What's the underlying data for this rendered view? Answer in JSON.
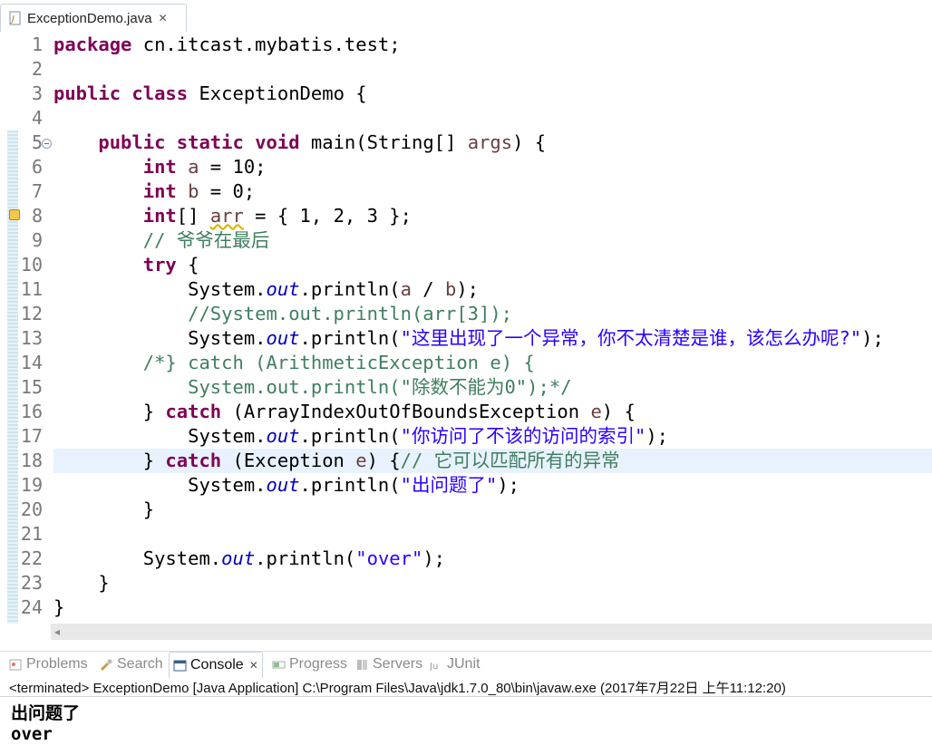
{
  "editor_tab": {
    "label": "ExceptionDemo.java"
  },
  "line_numbers": [
    "1",
    "2",
    "3",
    "4",
    "5",
    "6",
    "7",
    "8",
    "9",
    "10",
    "11",
    "12",
    "13",
    "14",
    "15",
    "16",
    "17",
    "18",
    "19",
    "20",
    "21",
    "22",
    "23",
    "24"
  ],
  "code": {
    "l1": [
      "package",
      " cn.itcast.mybatis.test;"
    ],
    "l3": [
      "public",
      " ",
      "class",
      " ExceptionDemo {"
    ],
    "l5": [
      "    ",
      "public",
      " ",
      "static",
      " ",
      "void",
      " main(String[] ",
      "args",
      ") {"
    ],
    "l6": [
      "        ",
      "int",
      " ",
      "a",
      " = 10;"
    ],
    "l7": [
      "        ",
      "int",
      " ",
      "b",
      " = 0;"
    ],
    "l8": [
      "        ",
      "int",
      "[] ",
      "arr",
      " = { 1, 2, 3 };"
    ],
    "l9": [
      "        ",
      "// 爷爷在最后"
    ],
    "l10": [
      "        ",
      "try",
      " {"
    ],
    "l11": [
      "            System.",
      "out",
      ".println(",
      "a",
      " / ",
      "b",
      ");"
    ],
    "l12": [
      "            ",
      "//System.out.println(arr[3]);"
    ],
    "l13": [
      "            System.",
      "out",
      ".println(",
      "\"这里出现了一个异常，你不太清楚是谁，该怎么办呢?\"",
      ");"
    ],
    "l14": [
      "        ",
      "/*} catch (ArithmeticException e) {"
    ],
    "l15": [
      "            ",
      "System.out.println(\"除数不能为0\");*/"
    ],
    "l16": [
      "        } ",
      "catch",
      " (ArrayIndexOutOfBoundsException ",
      "e",
      ") {"
    ],
    "l17": [
      "            System.",
      "out",
      ".println(",
      "\"你访问了不该的访问的索引\"",
      ");"
    ],
    "l18": [
      "        } ",
      "catch",
      " (Exception ",
      "e",
      ") {",
      "// 它可以匹配所有的异常"
    ],
    "l19": [
      "            System.",
      "out",
      ".println(",
      "\"出问题了\"",
      ");"
    ],
    "l20": [
      "        }"
    ],
    "l22": [
      "        System.",
      "out",
      ".println(",
      "\"over\"",
      ");"
    ],
    "l23": [
      "    }"
    ],
    "l24": [
      "}"
    ]
  },
  "view_tabs": {
    "problems": "Problems",
    "search": "Search",
    "console": "Console",
    "progress": "Progress",
    "servers": "Servers",
    "junit": "JUnit"
  },
  "console": {
    "status": "<terminated> ExceptionDemo [Java Application] C:\\Program Files\\Java\\jdk1.7.0_80\\bin\\javaw.exe (2017年7月22日 上午11:12:20)",
    "output": [
      "出问题了",
      "over"
    ]
  },
  "colors": {
    "keyword": "#7f0055",
    "string": "#2a00ff",
    "comment": "#3f7f5f",
    "static_field": "#0000c0",
    "local_variable": "#6a3e3e",
    "current_line": "#e8f2fe"
  }
}
